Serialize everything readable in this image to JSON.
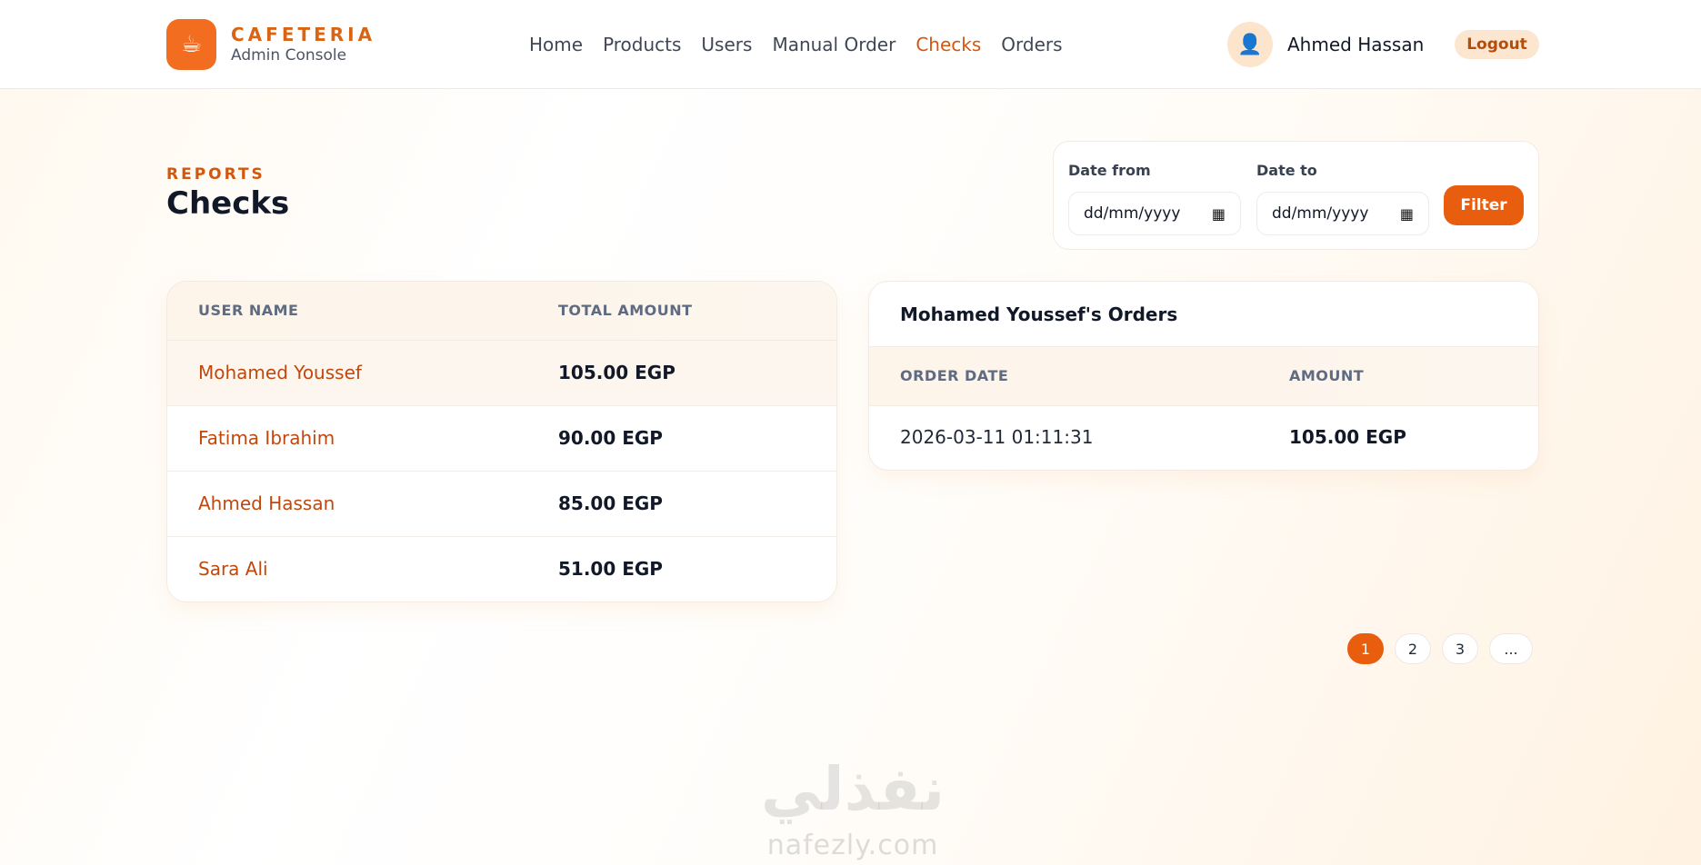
{
  "brand": {
    "name": "CAFETERIA",
    "subtitle": "Admin Console",
    "logo_icon": "coffee-cup-icon"
  },
  "nav": {
    "items": [
      {
        "label": "Home",
        "active": false
      },
      {
        "label": "Products",
        "active": false
      },
      {
        "label": "Users",
        "active": false
      },
      {
        "label": "Manual Order",
        "active": false
      },
      {
        "label": "Checks",
        "active": true
      },
      {
        "label": "Orders",
        "active": false
      }
    ]
  },
  "user": {
    "name": "Ahmed Hassan",
    "avatar_icon": "user-icon",
    "logout_label": "Logout"
  },
  "page": {
    "eyebrow": "REPORTS",
    "title": "Checks"
  },
  "filter": {
    "from_label": "Date from",
    "to_label": "Date to",
    "from_value": "dd/mm/yyyy",
    "to_value": "dd/mm/yyyy",
    "button_label": "Filter"
  },
  "checks_table": {
    "headers": [
      "USER NAME",
      "TOTAL AMOUNT"
    ],
    "rows": [
      {
        "name": "Mohamed Youssef",
        "amount": "105.00 EGP",
        "selected": true
      },
      {
        "name": "Fatima Ibrahim",
        "amount": "90.00 EGP",
        "selected": false
      },
      {
        "name": "Ahmed Hassan",
        "amount": "85.00 EGP",
        "selected": false
      },
      {
        "name": "Sara Ali",
        "amount": "51.00 EGP",
        "selected": false
      }
    ]
  },
  "orders_panel": {
    "title": "Mohamed Youssef's Orders",
    "headers": [
      "ORDER DATE",
      "AMOUNT"
    ],
    "rows": [
      {
        "date": "2026-03-11 01:11:31",
        "amount": "105.00 EGP"
      }
    ]
  },
  "pagination": {
    "pages": [
      "1",
      "2",
      "3"
    ],
    "current": "1",
    "more": "..."
  },
  "watermark": {
    "arabic": "نفذلي",
    "latin": "nafezly.com"
  },
  "colors": {
    "accent": "#e85d0e",
    "link": "#c0480d",
    "active_nav": "#d2570f"
  }
}
